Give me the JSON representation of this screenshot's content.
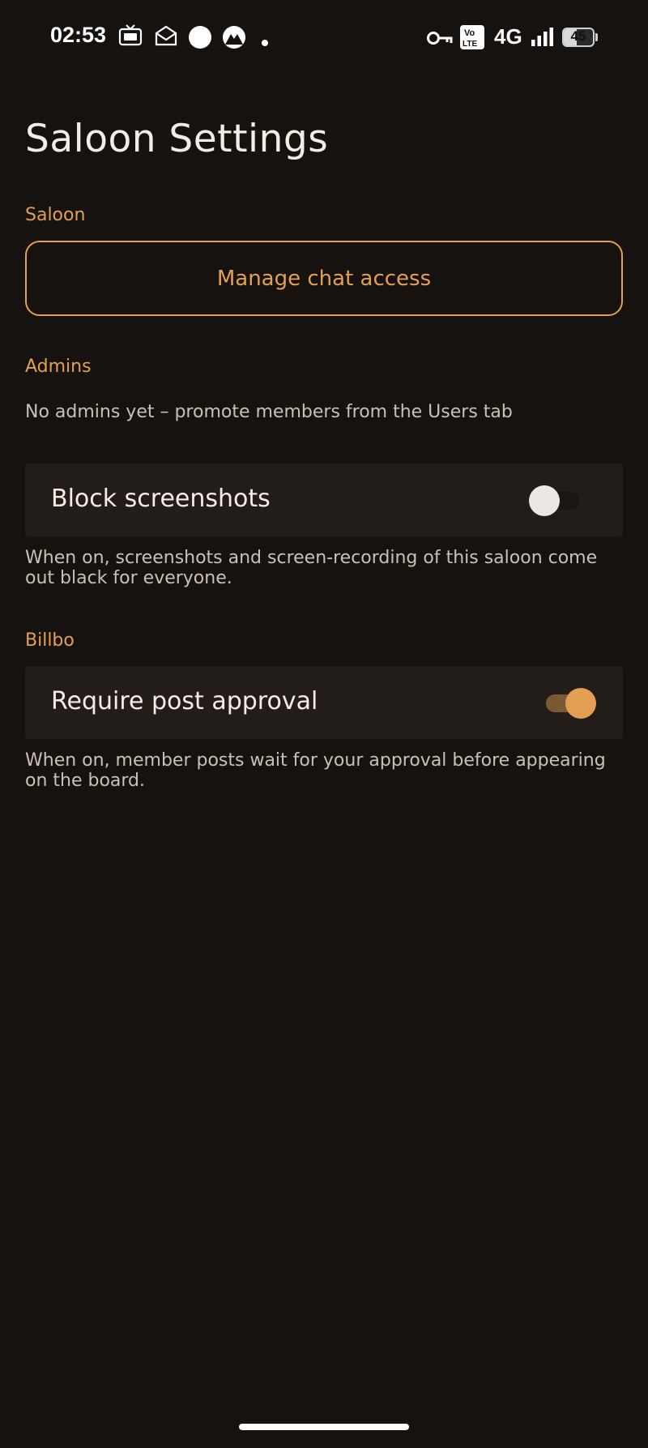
{
  "status_bar": {
    "time": "02:53",
    "network": "4G",
    "volte_line1": "Vo",
    "volte_line2": "LTE",
    "battery_level": "45",
    "icons": [
      "tv-app-icon",
      "mail-icon",
      "circle-icon",
      "mountain-app-icon",
      "dot-icon",
      "key-icon",
      "volte-icon",
      "signal-icon",
      "battery-icon"
    ]
  },
  "page": {
    "title": "Saloon Settings"
  },
  "sections": {
    "saloon": {
      "label": "Saloon",
      "manage_button": "Manage chat access"
    },
    "admins": {
      "label": "Admins",
      "empty_text": "No admins yet – promote members from the Users tab"
    },
    "block_screenshots": {
      "label": "Block screenshots",
      "enabled": false,
      "description": "When on, screenshots and screen-recording of this saloon come out black for everyone."
    },
    "billbo": {
      "label": "Billbo"
    },
    "post_approval": {
      "label": "Require post approval",
      "enabled": true,
      "description": "When on, member posts wait for your approval before appearing on the board."
    }
  },
  "colors": {
    "background": "#161210",
    "accent": "#e3a052",
    "card": "#231d19",
    "text_primary": "#f3ede5",
    "text_secondary": "#c9c1b6"
  }
}
